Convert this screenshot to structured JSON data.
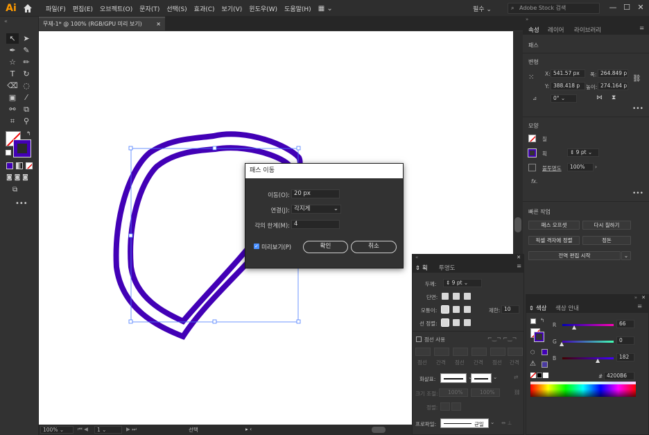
{
  "app": {
    "logo": "Ai",
    "home_icon": "home-icon"
  },
  "menu": [
    "파일(F)",
    "편집(E)",
    "오브젝트(O)",
    "문자(T)",
    "선택(S)",
    "효과(C)",
    "보기(V)",
    "윈도우(W)",
    "도움말(H)"
  ],
  "workspace": {
    "label": "필수",
    "search_placeholder": "Adobe Stock 검색"
  },
  "document": {
    "tab_label": "무제-1* @ 100% (RGB/GPU 미리 보기)",
    "close": "×"
  },
  "status": {
    "zoom": "100%",
    "artboard": "1",
    "tool": "선택"
  },
  "dialog": {
    "title": "패스 이동",
    "offset_label": "이동(O):",
    "offset_value": "20 px",
    "join_label": "연결(J):",
    "join_value": "각지게",
    "miter_label": "각의 한계(M):",
    "miter_value": "4",
    "preview_label": "미리보기(P)",
    "preview_checked": true,
    "ok_label": "확인",
    "cancel_label": "취소"
  },
  "properties": {
    "tabs": [
      "속성",
      "레이어",
      "라이브러리"
    ],
    "section_path": "패스",
    "transform_label": "변형",
    "x_label": "X:",
    "x_value": "541.57 px",
    "y_label": "Y:",
    "y_value": "388.418 p",
    "w_label": "폭:",
    "w_value": "264.849 p",
    "h_label": "높이:",
    "h_value": "274.164 p",
    "angle_value": "0°",
    "appearance_label": "모양",
    "fill_label": "칠",
    "stroke_label": "획",
    "stroke_value": "9 pt",
    "opacity_label": "불투명도",
    "opacity_value": "100%",
    "fx_label": "fx.",
    "quick_actions_label": "빠른 작업",
    "btn_offset_path": "패스 오프셋",
    "btn_recolor": "다시 칠하기",
    "btn_align_pixel": "픽셀 격자에 정렬",
    "btn_arrange": "정돈",
    "btn_global_edit": "전역 편집 시작",
    "more": "•••"
  },
  "stroke_panel": {
    "tabs": [
      "획",
      "투명도"
    ],
    "weight_label": "두께:",
    "weight_value": "9 pt",
    "cap_label": "단면:",
    "corner_label": "모퉁이:",
    "limit_label": "제한:",
    "limit_value": "10",
    "align_label": "선 정렬:",
    "dashed_label": "점선 사용",
    "dash_labels": [
      "점선",
      "간격",
      "점선",
      "간격",
      "점선",
      "간격"
    ],
    "arrow_label": "화살표:",
    "scale_label": "크기 조절:",
    "scale_value1": "100%",
    "scale_value2": "100%",
    "align_arrow_label": "정렬:",
    "profile_label": "프로파일:",
    "profile_value": "균일"
  },
  "color_panel": {
    "tabs": [
      "색상",
      "색상 안내"
    ],
    "r_label": "R",
    "r_value": "66",
    "g_label": "G",
    "g_value": "0",
    "b_label": "B",
    "b_value": "182",
    "hex_label": "#",
    "hex_value": "4200B6"
  },
  "colors": {
    "stroke": "#4200B6",
    "canvas": "#ffffff",
    "selection": "#4a7cff",
    "logo": "#ff9a00"
  }
}
